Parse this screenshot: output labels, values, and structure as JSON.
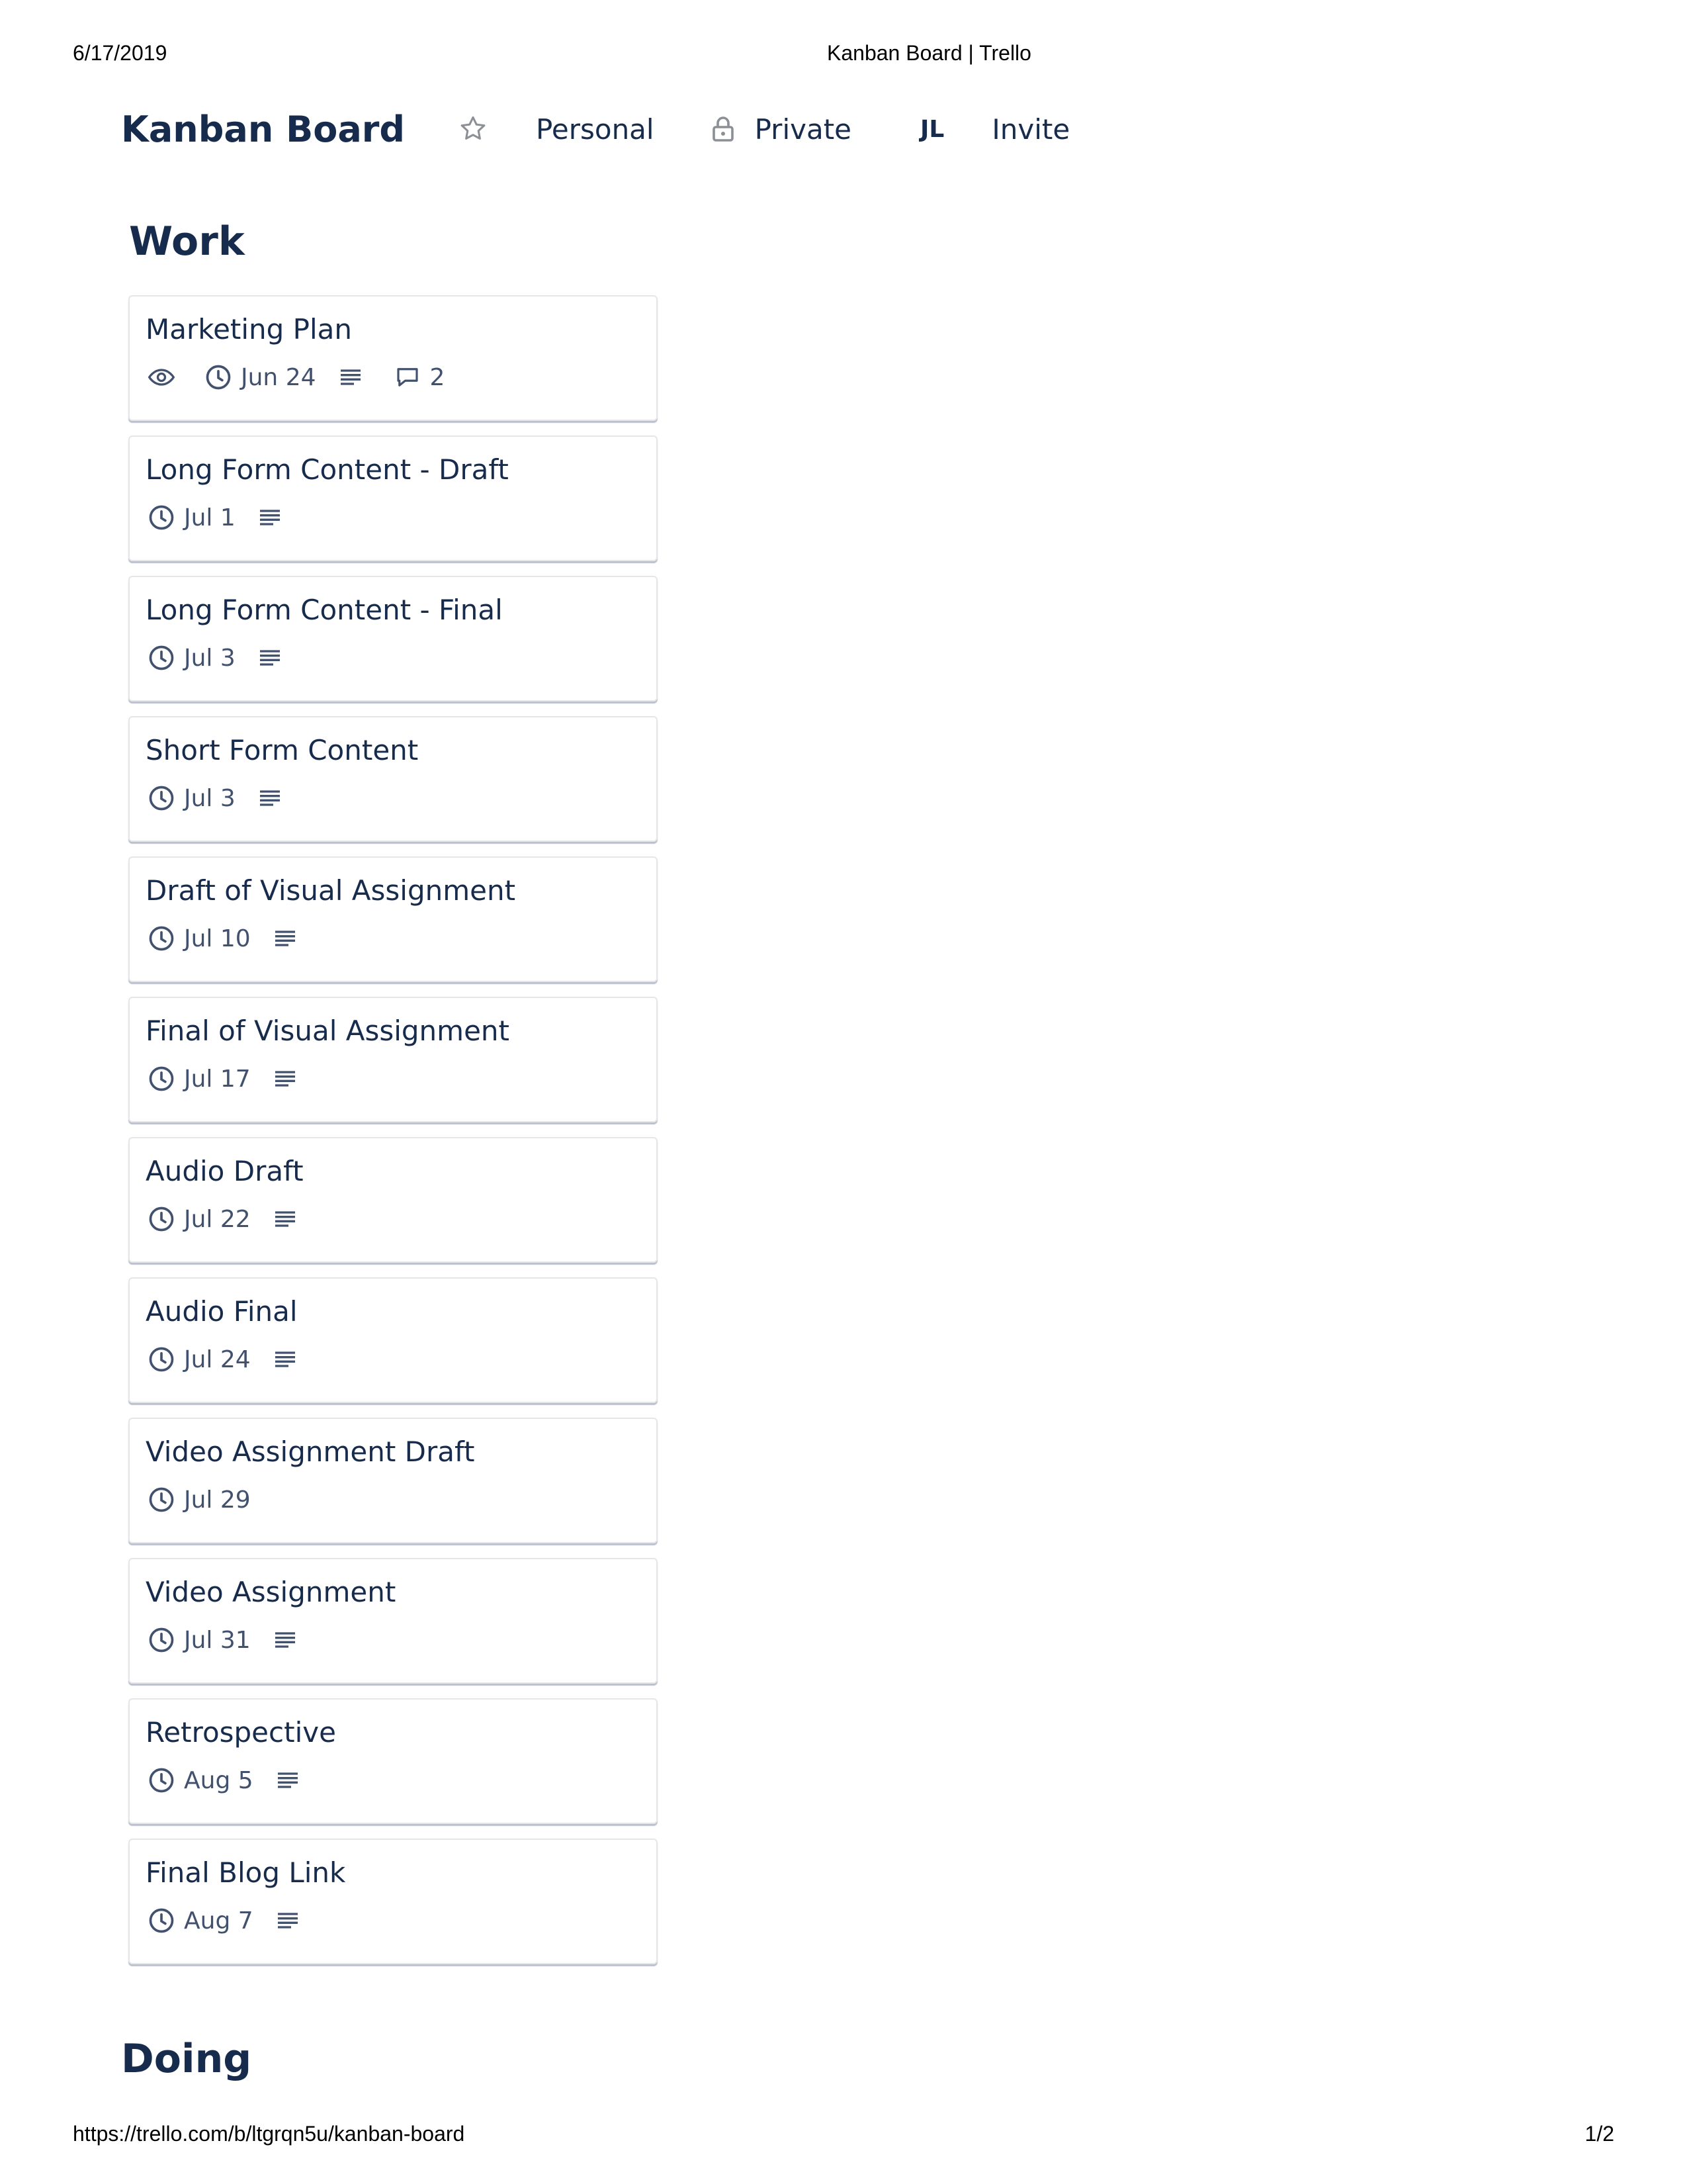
{
  "print": {
    "date": "6/17/2019",
    "page_title": "Kanban Board | Trello",
    "url": "https://trello.com/b/ltgrqn5u/kanban-board",
    "page_number": "1/2"
  },
  "header": {
    "board_title": "Kanban Board",
    "star_icon": "star-icon",
    "team": "Personal",
    "visibility_icon": "lock-icon",
    "visibility": "Private",
    "member_initials": "JL",
    "invite": "Invite"
  },
  "lists": [
    {
      "title": "Work",
      "cards": [
        {
          "title": "Marketing Plan",
          "watching": true,
          "due": "Jun 24",
          "has_description": true,
          "comments": "2"
        },
        {
          "title": "Long Form Content - Draft",
          "due": "Jul 1",
          "has_description": true
        },
        {
          "title": "Long Form Content - Final",
          "due": "Jul 3",
          "has_description": true
        },
        {
          "title": "Short Form Content",
          "due": "Jul 3",
          "has_description": true
        },
        {
          "title": "Draft of Visual Assignment",
          "due": "Jul 10",
          "has_description": true
        },
        {
          "title": "Final of Visual Assignment",
          "due": "Jul 17",
          "has_description": true
        },
        {
          "title": "Audio Draft",
          "due": "Jul 22",
          "has_description": true
        },
        {
          "title": "Audio Final",
          "due": "Jul 24",
          "has_description": true
        },
        {
          "title": "Video Assignment Draft",
          "due": "Jul 29",
          "has_description": false
        },
        {
          "title": "Video Assignment",
          "due": "Jul 31",
          "has_description": true
        },
        {
          "title": "Retrospective",
          "due": "Aug 5",
          "has_description": true
        },
        {
          "title": "Final Blog Link",
          "due": "Aug 7",
          "has_description": true
        }
      ]
    },
    {
      "title": "Doing",
      "cards": []
    }
  ],
  "colors": {
    "text_primary": "#172b4d",
    "text_badge": "#42526e",
    "card_border": "#e4e6ea",
    "icon_muted": "#8c8f96"
  }
}
